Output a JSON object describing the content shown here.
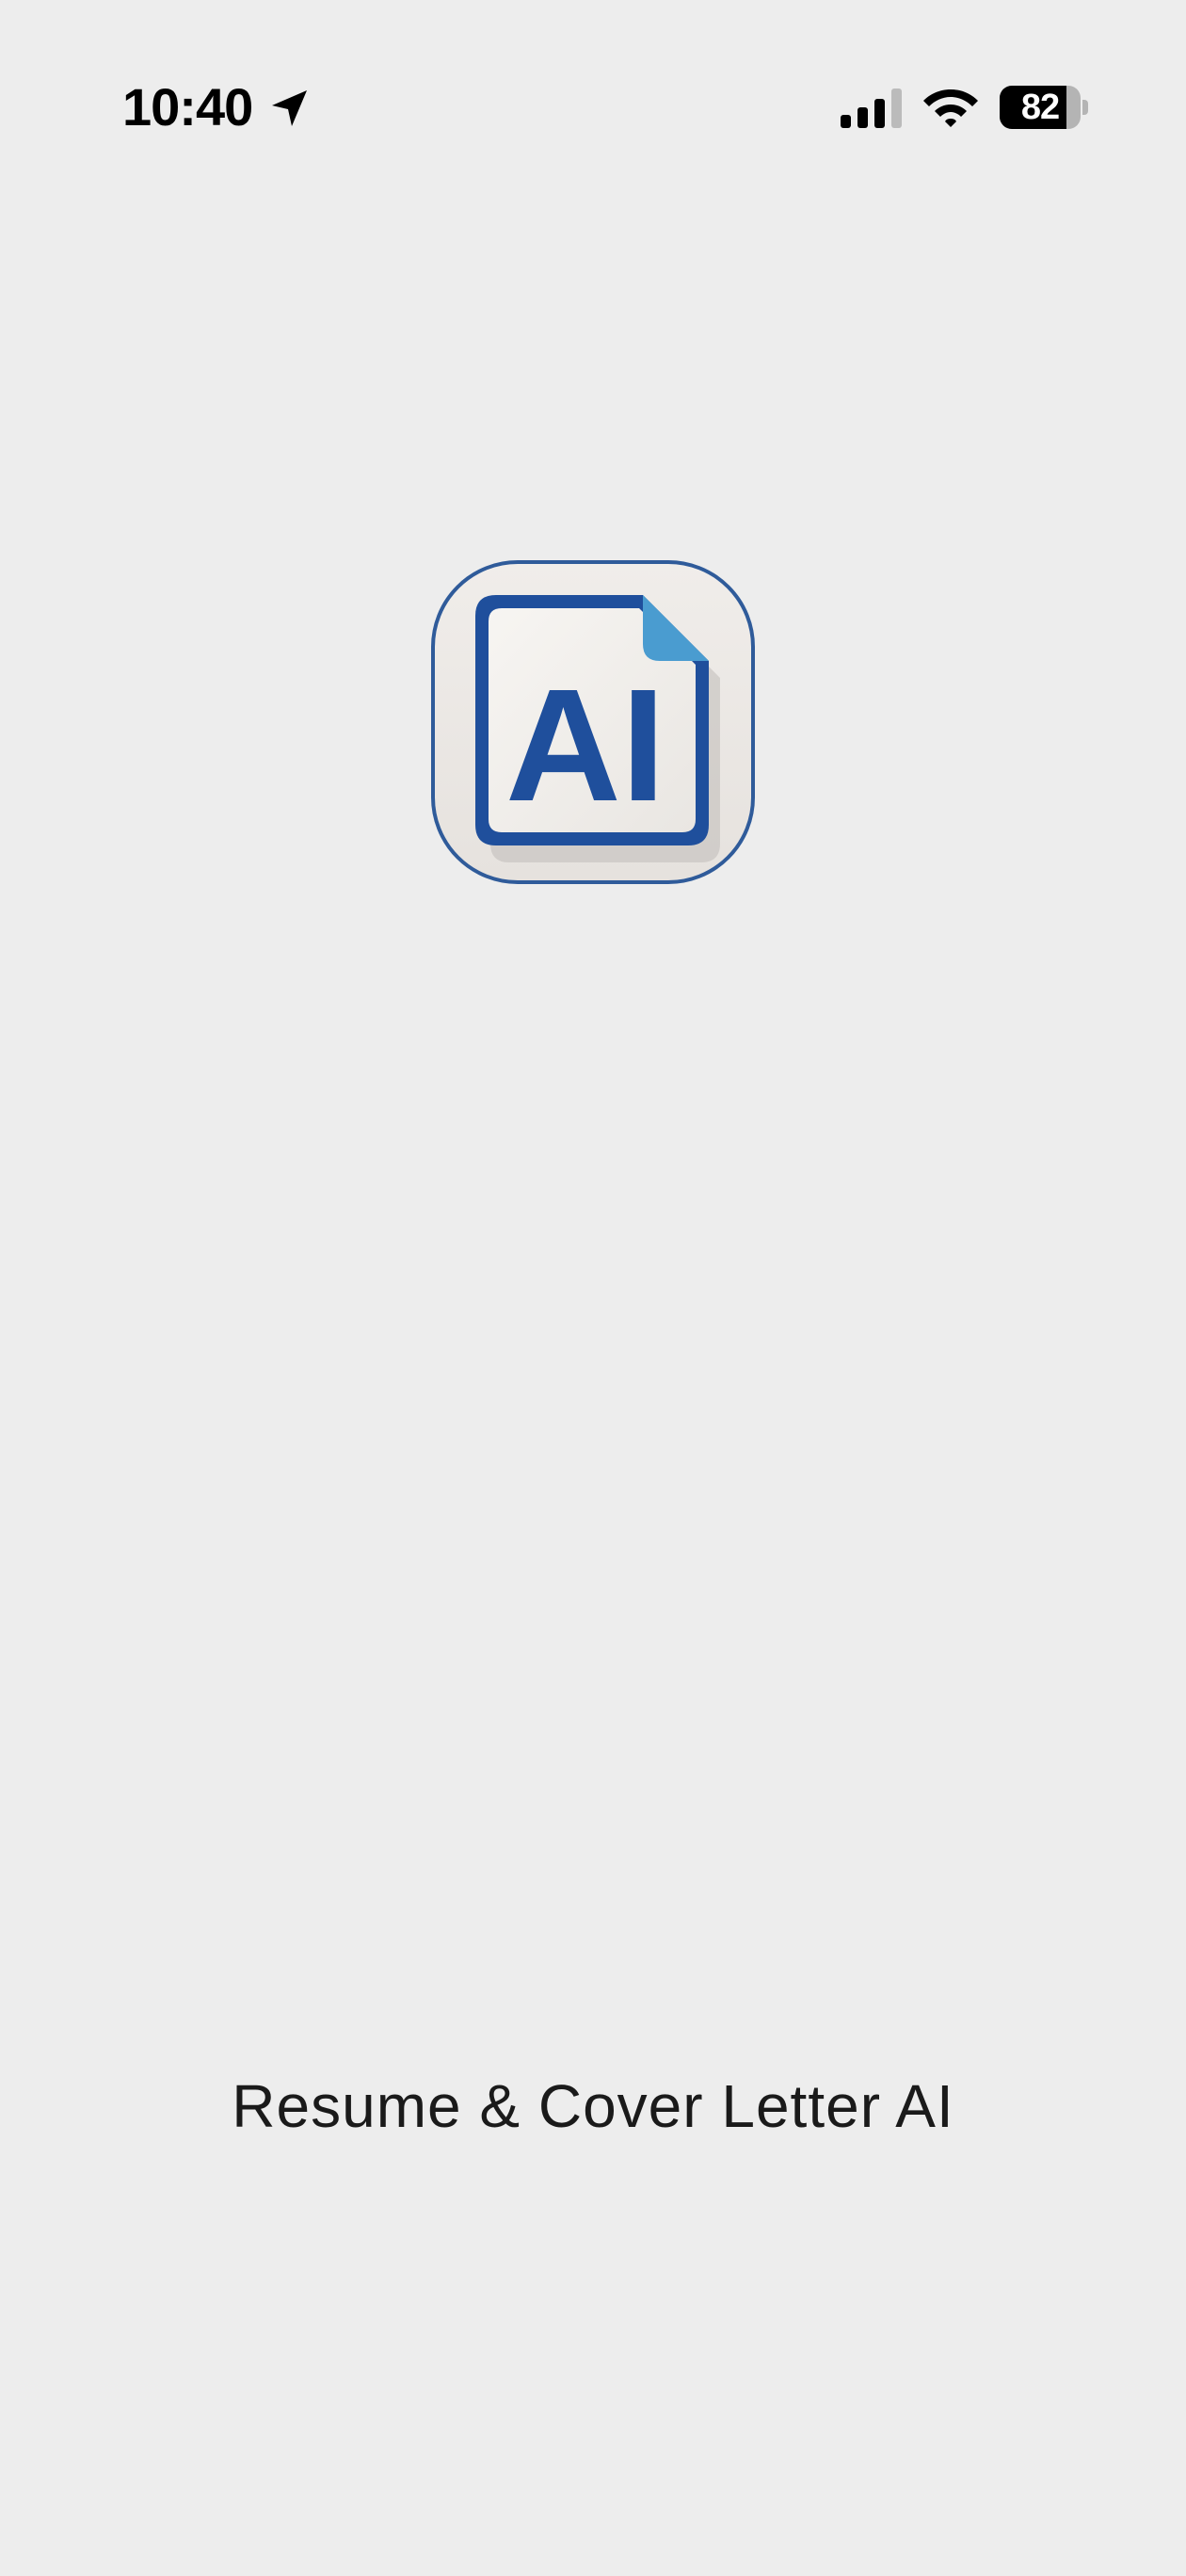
{
  "status_bar": {
    "time": "10:40",
    "battery_level": "82",
    "battery_fraction": 0.82,
    "icons": [
      "location-arrow-icon",
      "cellular-signal-icon",
      "wifi-icon",
      "battery-icon"
    ]
  },
  "splash": {
    "logo_text": "AI",
    "app_name": "Resume & Cover Letter AI"
  },
  "colors": {
    "background": "#ededed",
    "logo_blue": "#1f4f9c",
    "logo_corner": "#4a9cd0"
  }
}
